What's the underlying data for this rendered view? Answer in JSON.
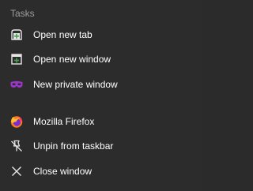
{
  "jumplist": {
    "section_title": "Tasks",
    "tasks": [
      {
        "label": "Open new tab",
        "icon": "new-tab-icon"
      },
      {
        "label": "Open new window",
        "icon": "new-window-icon"
      },
      {
        "label": "New private window",
        "icon": "private-mask-icon"
      }
    ],
    "app_actions": [
      {
        "label": "Mozilla Firefox",
        "icon": "firefox-logo-icon"
      },
      {
        "label": "Unpin from taskbar",
        "icon": "unpin-icon"
      },
      {
        "label": "Close window",
        "icon": "close-icon"
      }
    ]
  },
  "colors": {
    "background": "#2c2c2c",
    "section_title": "#9d9d9d",
    "text": "#ffffff",
    "green_plus": "#3fa34d",
    "private_purple": "#9b35c9"
  }
}
